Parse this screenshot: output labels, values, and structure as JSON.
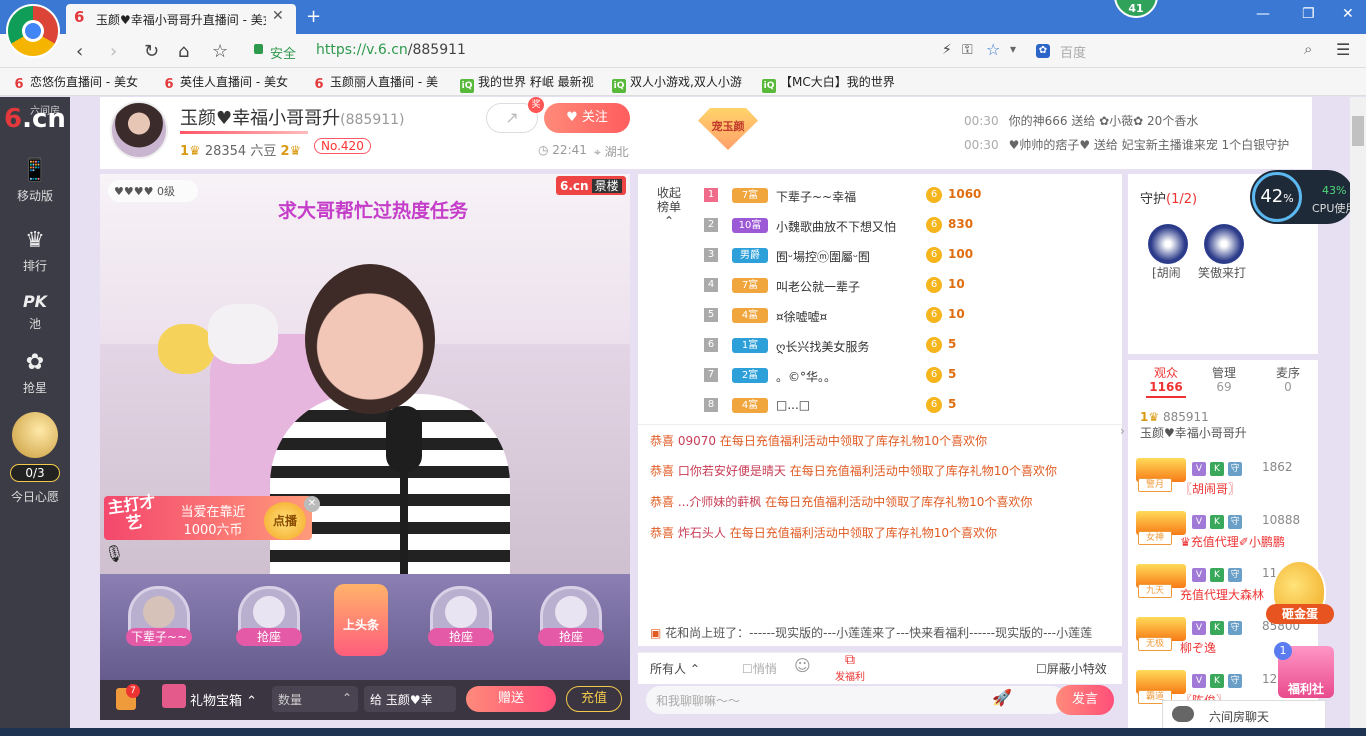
{
  "browser": {
    "tab_title": "玉颜♥幸福小哥哥升直播间 - 美女",
    "tab_logo": "6",
    "new_tab": "+",
    "badge": "41",
    "secure": "安全",
    "url_host": "https://v.6.cn",
    "url_path": "/885911",
    "search_placeholder": "百度",
    "bookmarks": [
      {
        "icon": "6",
        "label": "恋悠伤直播间 - 美女"
      },
      {
        "icon": "6",
        "label": "英佳人直播间 - 美女"
      },
      {
        "icon": "6",
        "label": "玉颜丽人直播间 - 美"
      },
      {
        "icon": "iQ",
        "label": "我的世界 籽岷 最新视"
      },
      {
        "icon": "iQ",
        "label": "双人小游戏,双人小游"
      },
      {
        "icon": "iQ",
        "label": "【MC大白】我的世界"
      }
    ]
  },
  "sidebar": {
    "logo_six": "6",
    "logo_cn": ".cn",
    "logo_sub": "六间房",
    "items": [
      {
        "icon": "📱",
        "label": "移动版"
      },
      {
        "icon": "♛",
        "label": "排行"
      },
      {
        "icon": "PK",
        "label": "池"
      },
      {
        "icon": "✿",
        "label": "抢星"
      }
    ],
    "wish_count": "0/3",
    "wish_label": "今日心愿"
  },
  "header": {
    "room_name": "玉颜♥幸福小哥哥升",
    "room_id": "(885911)",
    "level_crown_1": "1♛",
    "beans": "28354 六豆",
    "level_crown_2": "2♛",
    "rank": "No.420",
    "share_tag": "奖",
    "follow": "关注",
    "time": "22:41",
    "place": "湖北",
    "pet_badge": "宠玉颜",
    "gift_news": [
      {
        "time": "00:30",
        "text": "你的神666 送给 ✿小薇✿ 20个香水"
      },
      {
        "time": "00:30",
        "text": "♥帅帅的痞子♥ 送给 妃宝新主播谁来宠 1个白银守护"
      }
    ]
  },
  "video": {
    "mission": "求大哥帮忙过热度任务",
    "level_pill": "♥♥♥♥ 0级",
    "logo": "6.cn",
    "logo_tag": "景楼",
    "talent_tag": "主打才艺",
    "talent_text": "当爱在靠近 1000六币",
    "talent_btn": "点播"
  },
  "seats": [
    {
      "label": "下辈子~~"
    },
    {
      "label": "抢座"
    },
    {
      "label": "抢座"
    },
    {
      "label": "抢座"
    }
  ],
  "headline": "上头条",
  "giftbar": {
    "bag_count": "7",
    "gift_box": "礼物宝箱",
    "quantity": "数量",
    "to": "给 玉颜♥幸",
    "send": "赠送",
    "recharge": "充值"
  },
  "rank": {
    "collapse_label": "收起榜单",
    "rows": [
      {
        "no": "1",
        "level": "7富",
        "name": "下辈子~~幸福",
        "value": "1060"
      },
      {
        "no": "2",
        "level": "10富",
        "name": "小魏歌曲放不下想又怕",
        "value": "830"
      },
      {
        "no": "3",
        "level": "男爵",
        "name": "囿ᵕ場控ⓜ圍屬ᵕ囿",
        "value": "100"
      },
      {
        "no": "4",
        "level": "7富",
        "name": "叫老公就一辈子",
        "value": "10"
      },
      {
        "no": "5",
        "level": "4富",
        "name": "¤徐嘘嘘¤",
        "value": "10"
      },
      {
        "no": "6",
        "level": "1富",
        "name": "ღ长兴找美女服务",
        "value": "5"
      },
      {
        "no": "7",
        "level": "2富",
        "name": "。©°华。。",
        "value": "5"
      },
      {
        "no": "8",
        "level": "4富",
        "name": "□...□",
        "value": "5"
      }
    ]
  },
  "chat": {
    "messages": [
      {
        "prefix": "恭喜",
        "user": "09070",
        "text": "在每日充值福利活动中领取了库存礼物10个喜欢你"
      },
      {
        "prefix": "恭喜",
        "user": "口你若安好便是晴天",
        "text": "在每日充值福利活动中领取了库存礼物10个喜欢你"
      },
      {
        "prefix": "恭喜",
        "user": "...介师妹的蓒枫",
        "text": "在每日充值福利活动中领取了库存礼物10个喜欢你"
      },
      {
        "prefix": "恭喜",
        "user": "炸石头人",
        "text": "在每日充值福利活动中领取了库存礼物10个喜欢你"
      }
    ],
    "marquee": "花和尚上班了：------现实版的---小莲莲来了---快来看福利------现实版的---小莲莲",
    "all_people": "所有人",
    "whisper": "悄悄",
    "fuli": "发福利",
    "block": "屏蔽小特效",
    "input_placeholder": "和我聊聊嘛～～",
    "send": "发言"
  },
  "guard": {
    "title": "守护",
    "count": "(1/2)",
    "members": [
      "⁅胡闹",
      "笑傲来打"
    ]
  },
  "cpu": {
    "value": "42",
    "unit": "%",
    "usage": "43%",
    "label": "CPU使用"
  },
  "audience": {
    "tabs": [
      {
        "label": "观众",
        "num": "1166"
      },
      {
        "label": "管理",
        "num": "69"
      },
      {
        "label": "麦序",
        "num": "0"
      }
    ],
    "host": {
      "id": "885911",
      "name": "玉颜♥幸福小哥哥升"
    },
    "rows": [
      {
        "tag": "警月",
        "id": "1862",
        "name": "〖胡闹哥〗"
      },
      {
        "tag": "女神",
        "id": "10888",
        "name": "♛充值代理✐小鹏鹏"
      },
      {
        "tag": "九天",
        "id": "11",
        "name": "充值代理大森林"
      },
      {
        "tag": "无极",
        "id": "85800",
        "name": "柳ぞ逸"
      },
      {
        "tag": "霸道",
        "id": "12825",
        "name": "〖陈俊〗"
      }
    ]
  },
  "widgets": {
    "egg": "砸金蛋",
    "welfare_count": "1",
    "welfare": "福利社",
    "chat_6": "六间房聊天"
  }
}
